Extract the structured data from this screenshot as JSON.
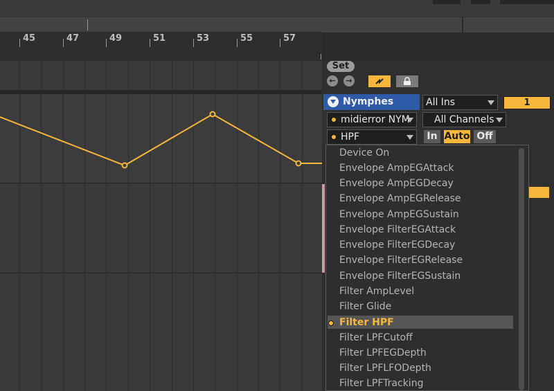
{
  "ruler": {
    "labels": [
      "45",
      "47",
      "49",
      "51",
      "53",
      "55",
      "57"
    ]
  },
  "set_panel": {
    "set_label": "Set",
    "prev_icon": "arrow-left-icon",
    "next_icon": "arrow-right-icon",
    "draw_icon": "draw-mode-icon",
    "lock_icon": "lock-icon"
  },
  "track": {
    "name": "Nymphes",
    "device": "midierror NYM",
    "parameter": "HPF",
    "input_type": "All Ins",
    "input_channel": "All Channels",
    "monitor": [
      "In",
      "Auto",
      "Off"
    ],
    "number": "1"
  },
  "menu": {
    "selected": "Filter HPF",
    "items": [
      "Device On",
      "Envelope AmpEGAttack",
      "Envelope AmpEGDecay",
      "Envelope AmpEGRelease",
      "Envelope AmpEGSustain",
      "Envelope FilterEGAttack",
      "Envelope FilterEGDecay",
      "Envelope FilterEGRelease",
      "Envelope FilterEGSustain",
      "Filter AmpLevel",
      "Filter Glide",
      "Filter HPF",
      "Filter LPFCutoff",
      "Filter LPFEGDepth",
      "Filter LPFLFODepth",
      "Filter LPFTracking"
    ]
  },
  "colors": {
    "accent": "#f7b73c",
    "track_blue": "#2f5aa8"
  }
}
